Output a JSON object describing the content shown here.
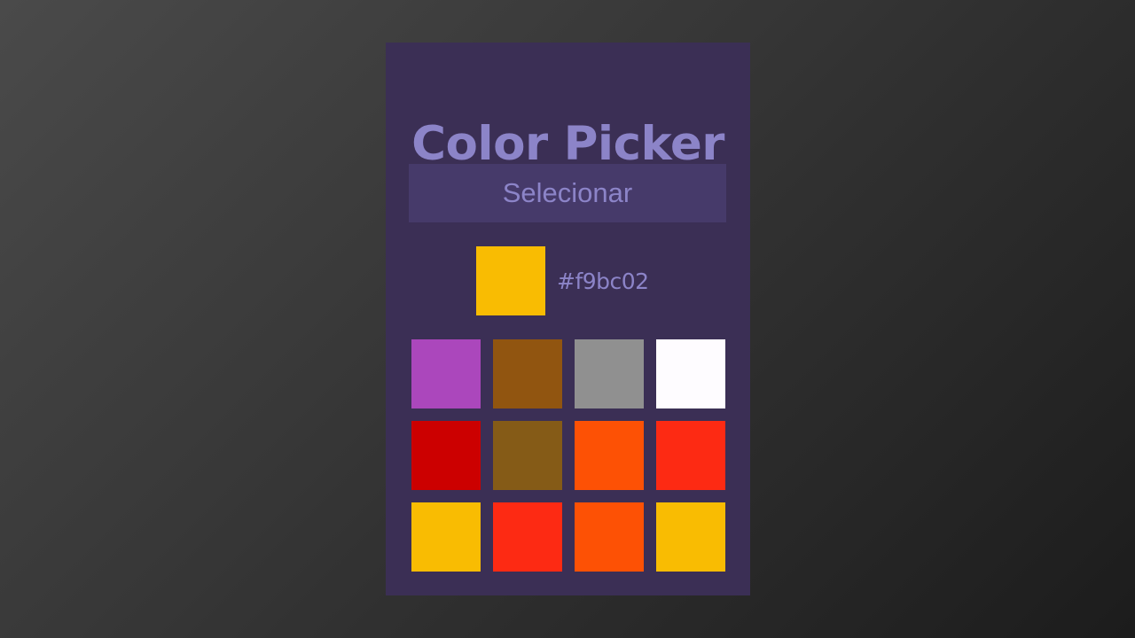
{
  "panel": {
    "title": "Color Picker",
    "select_button_label": "Selecionar",
    "selected": {
      "hex_label": "#f9bc02",
      "color": "#f9bc02"
    },
    "swatches": [
      "#ab47bc",
      "#915510",
      "#909090",
      "#fefcff",
      "#cc0000",
      "#855b17",
      "#fd5105",
      "#fd2a13",
      "#f9bc02",
      "#fd2a13",
      "#fd5105",
      "#f9bc02"
    ]
  },
  "colors": {
    "panel_background": "#3b2f55",
    "button_background": "#463a6a",
    "accent_text": "#8c84c8"
  }
}
